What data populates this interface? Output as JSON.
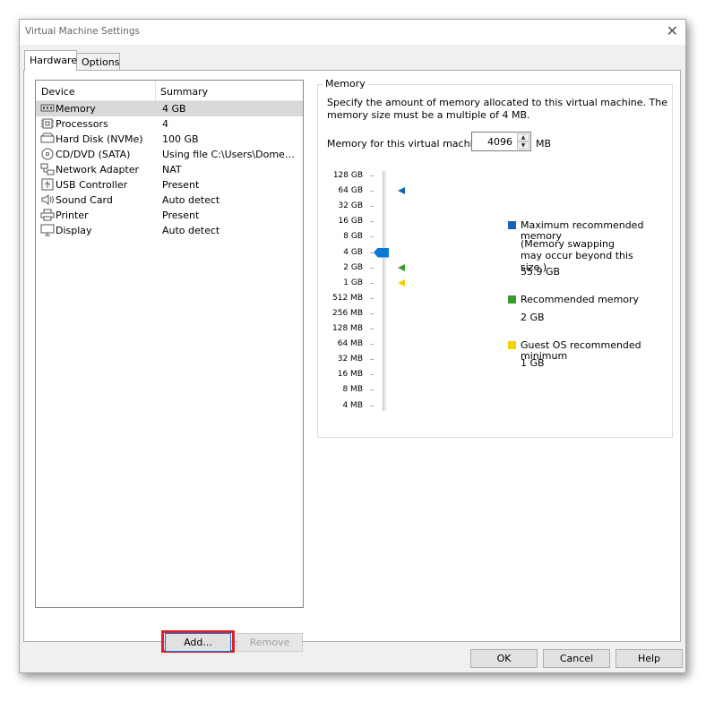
{
  "window": {
    "title": "Virtual Machine Settings"
  },
  "tabs": [
    {
      "label": "Hardware"
    },
    {
      "label": "Options"
    }
  ],
  "device_list": {
    "columns": {
      "device": "Device",
      "summary": "Summary"
    },
    "rows": [
      {
        "icon": "memory-icon",
        "device": "Memory",
        "summary": "4 GB"
      },
      {
        "icon": "processor-icon",
        "device": "Processors",
        "summary": "4"
      },
      {
        "icon": "hard-disk-icon",
        "device": "Hard Disk (NVMe)",
        "summary": "100 GB"
      },
      {
        "icon": "cd-dvd-icon",
        "device": "CD/DVD (SATA)",
        "summary": "Using file C:\\Users\\Domenico..."
      },
      {
        "icon": "network-adapter-icon",
        "device": "Network Adapter",
        "summary": "NAT"
      },
      {
        "icon": "usb-icon",
        "device": "USB Controller",
        "summary": "Present"
      },
      {
        "icon": "sound-card-icon",
        "device": "Sound Card",
        "summary": "Auto detect"
      },
      {
        "icon": "printer-icon",
        "device": "Printer",
        "summary": "Present"
      },
      {
        "icon": "display-icon",
        "device": "Display",
        "summary": "Auto detect"
      }
    ]
  },
  "buttons": {
    "add": "Add...",
    "remove": "Remove",
    "ok": "OK",
    "cancel": "Cancel",
    "help": "Help"
  },
  "memory": {
    "group_title": "Memory",
    "description": "Specify the amount of memory allocated to this virtual machine. The memory size must be a multiple of 4 MB.",
    "field_label": "Memory for this virtual machine:",
    "value": "4096",
    "unit": "MB",
    "scale": [
      "128 GB",
      "64 GB",
      "32 GB",
      "16 GB",
      "8 GB",
      "4 GB",
      "2 GB",
      "1 GB",
      "512 MB",
      "256 MB",
      "128 MB",
      "64 MB",
      "32 MB",
      "16 MB",
      "8 MB",
      "4 MB"
    ],
    "current_level": "4 GB",
    "markers": {
      "max_recommended": "64 GB",
      "recommended": "2 GB",
      "guest_min": "1 GB"
    },
    "legend": {
      "max": {
        "label": "Maximum recommended memory",
        "note": "(Memory swapping may occur beyond this size.)",
        "value": "55.9 GB",
        "color": "#1264b4"
      },
      "recommended": {
        "label": "Recommended memory",
        "value": "2 GB",
        "color": "#3c9a2a"
      },
      "guest_min": {
        "label": "Guest OS recommended minimum",
        "value": "1 GB",
        "color": "#f0d200"
      }
    }
  },
  "colors": {
    "slider_thumb": "#0b7ad4",
    "highlight_box": "#e31e24"
  }
}
